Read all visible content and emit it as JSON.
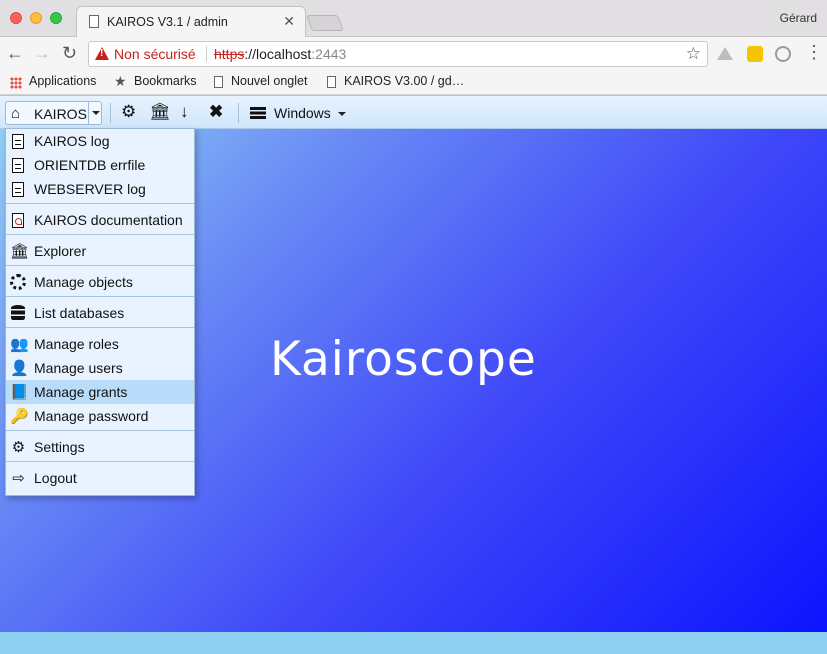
{
  "browser": {
    "tab_title": "KAIROS V3.1 / admin",
    "tab_close": "✕",
    "profile_name": "Gérard",
    "not_secure_label": "Non sécurisé",
    "url_scheme": "https",
    "url_sep": "://",
    "url_host": "localhost",
    "url_port": ":2443",
    "bookmarks": [
      "Applications",
      "Bookmarks",
      "Nouvel onglet",
      "KAIROS V3.00 / gd…"
    ]
  },
  "toolbar": {
    "home_label": "KAIROS",
    "windows_label": "Windows",
    "icons": [
      "gear-icon",
      "bank-icon",
      "arrow-down-icon",
      "close-icon",
      "list-icon"
    ]
  },
  "menu": {
    "items": [
      {
        "label": "KAIROS log",
        "icon": "file-text-icon"
      },
      {
        "label": "ORIENTDB errfile",
        "icon": "file-text-icon"
      },
      {
        "label": "WEBSERVER log",
        "icon": "file-text-icon"
      },
      {
        "label": "KAIROS documentation",
        "icon": "file-pdf-icon"
      },
      {
        "label": "Explorer",
        "icon": "bank-icon"
      },
      {
        "label": "Manage objects",
        "icon": "spinner-icon"
      },
      {
        "label": "List databases",
        "icon": "database-icon"
      },
      {
        "label": "Manage roles",
        "icon": "users-icon"
      },
      {
        "label": "Manage users",
        "icon": "user-icon"
      },
      {
        "label": "Manage grants",
        "icon": "book-icon"
      },
      {
        "label": "Manage password",
        "icon": "key-icon"
      },
      {
        "label": "Settings",
        "icon": "gear-icon"
      },
      {
        "label": "Logout",
        "icon": "sign-out-icon"
      }
    ],
    "active_item": "Manage grants"
  },
  "brand": "Kairoscope",
  "colors": {
    "gradient_start": "#96d6f4",
    "gradient_end": "#0d14ff",
    "menu_bg": "#e8f3ff",
    "menu_active": "#b9dcfb",
    "not_secure": "#c5221f"
  }
}
